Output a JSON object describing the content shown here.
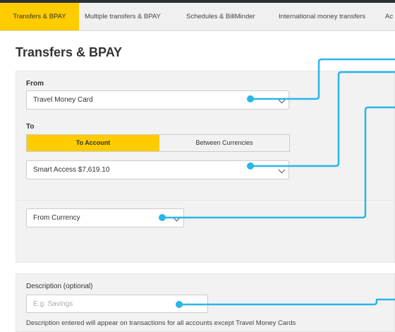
{
  "tabs": [
    {
      "label": "Transfers & BPAY",
      "active": true
    },
    {
      "label": "Multiple transfers & BPAY",
      "active": false
    },
    {
      "label": "Schedules & BillMinder",
      "active": false
    },
    {
      "label": "International money transfers",
      "active": false
    },
    {
      "label": "Ac",
      "active": false
    }
  ],
  "page": {
    "title": "Transfers & BPAY"
  },
  "accounts": {
    "from_label": "From",
    "from_value": "Travel Money Card",
    "to_label": "To",
    "to_toggle": {
      "option_1": "To Account",
      "option_2": "Between Currencies",
      "selected": "To Account"
    },
    "to_value": "Smart Access $7,619.10"
  },
  "currency": {
    "from_currency_value": "From Currency"
  },
  "description": {
    "label": "Description (optional)",
    "placeholder": "E.g. Savings",
    "hint": "Description entered will appear on transactions for all accounts except Travel Money Cards"
  },
  "colors": {
    "accent": "#ffcc00",
    "callout": "#29b6e8",
    "panel": "#f2f2f2",
    "topbar": "#2c3136"
  }
}
